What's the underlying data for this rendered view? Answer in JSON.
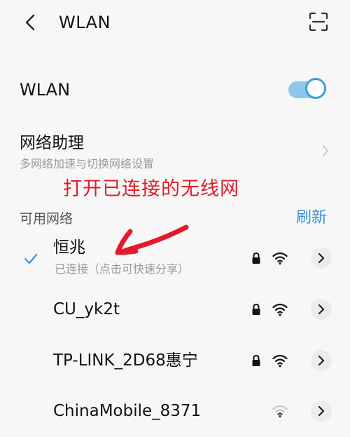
{
  "header": {
    "title": "WLAN"
  },
  "wlan": {
    "label": "WLAN",
    "enabled": true,
    "accent": "#3aa0d8"
  },
  "assistant": {
    "title": "网络助理",
    "subtitle": "多网络加速与切换网络设置"
  },
  "annotation": {
    "text": "打开已连接的无线网",
    "color": "#e21b2b"
  },
  "available": {
    "label": "可用网络",
    "refresh_label": "刷新"
  },
  "networks": [
    {
      "name": "恒兆",
      "status": "已连接（点击可快速分享）",
      "connected": true,
      "secured": true,
      "icons": [
        "check-icon",
        "lock-icon",
        "wifi-icon",
        "chevron-right-icon"
      ]
    },
    {
      "name": "CU_yk2t",
      "secured": true,
      "icons": [
        "lock-icon",
        "wifi-icon",
        "chevron-right-icon"
      ]
    },
    {
      "name": "TP-LINK_2D68惠宁",
      "secured": true,
      "icons": [
        "lock-icon",
        "wifi-icon",
        "chevron-right-icon"
      ]
    },
    {
      "name": "ChinaMobile_8371",
      "secured": false,
      "icons": [
        "wifi-icon",
        "chevron-right-icon"
      ]
    }
  ]
}
